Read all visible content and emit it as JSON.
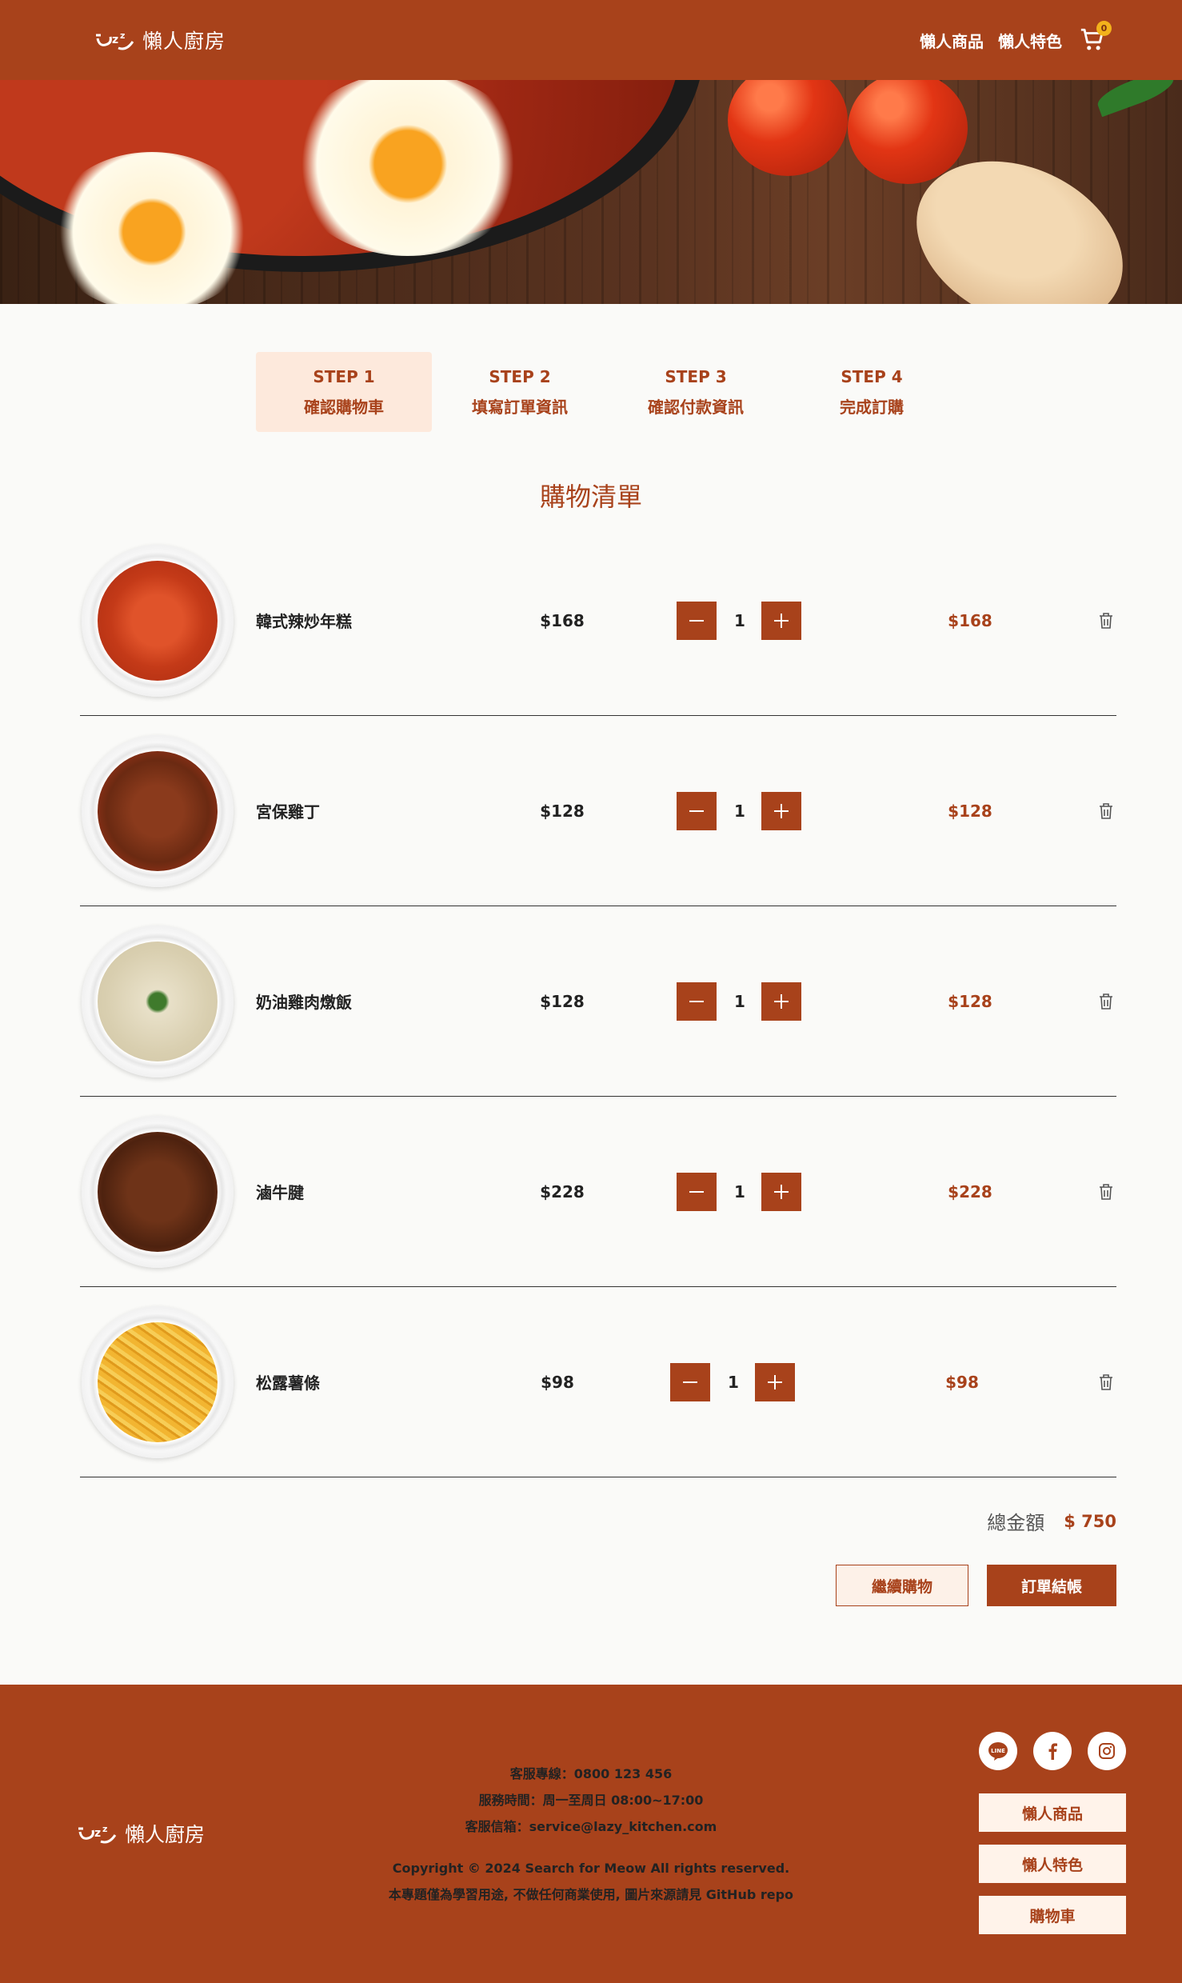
{
  "header": {
    "brand": "懶人廚房",
    "nav": [
      "懶人商品",
      "懶人特色"
    ],
    "cart_count": "0"
  },
  "steps": [
    {
      "step": "STEP 1",
      "label": "確認購物車"
    },
    {
      "step": "STEP 2",
      "label": "填寫訂單資訊"
    },
    {
      "step": "STEP 3",
      "label": "確認付款資訊"
    },
    {
      "step": "STEP 4",
      "label": "完成訂購"
    }
  ],
  "cart": {
    "title": "購物清單",
    "items": [
      {
        "name": "韓式辣炒年糕",
        "price": "$168",
        "qty": "1",
        "subtotal": "$168"
      },
      {
        "name": "宮保雞丁",
        "price": "$128",
        "qty": "1",
        "subtotal": "$128"
      },
      {
        "name": "奶油雞肉燉飯",
        "price": "$128",
        "qty": "1",
        "subtotal": "$128"
      },
      {
        "name": "滷牛腱",
        "price": "$228",
        "qty": "1",
        "subtotal": "$228"
      },
      {
        "name": "松露薯條",
        "price": "$98",
        "qty": "1",
        "subtotal": "$98"
      }
    ],
    "total_label": "總金額",
    "total_value": "$ 750",
    "continue_label": "繼續購物",
    "checkout_label": "訂單結帳"
  },
  "footer": {
    "brand": "懶人廚房",
    "hotline": "客服專線：0800 123 456",
    "hours": "服務時間：周一至周日 08:00~17:00",
    "email": "客服信箱：service@lazy_kitchen.com",
    "copyright": "Copyright © 2024 Search for Meow All rights reserved.",
    "disclaimer": "本專題僅為學習用途, 不做任何商業使用, 圖片來源請見 GitHub repo",
    "links": [
      "懶人商品",
      "懶人特色",
      "購物車"
    ],
    "social_line": "LINE"
  },
  "colors": {
    "brand": "#a8421b",
    "step_active_bg": "#fde9dc",
    "badge": "#f3b21b"
  }
}
